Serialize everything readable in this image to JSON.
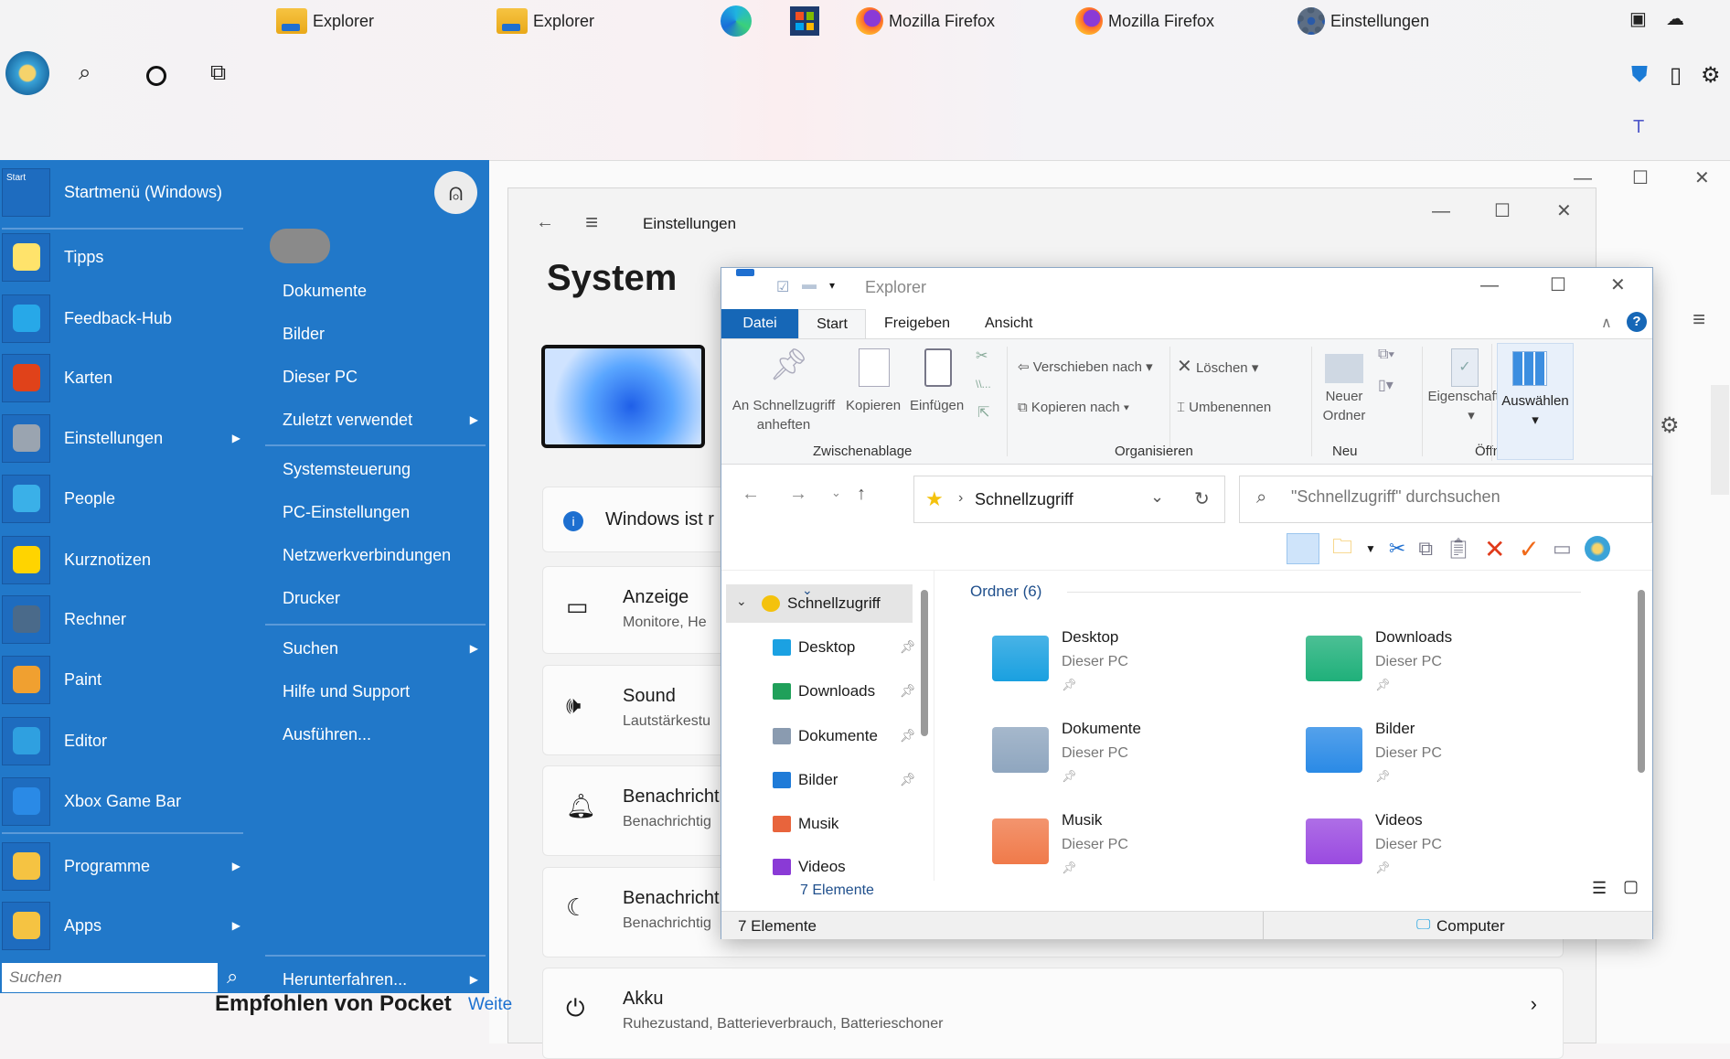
{
  "taskbar": {
    "items": [
      {
        "label": "Explorer",
        "icon": "folder-icon"
      },
      {
        "label": "Explorer",
        "icon": "folder-icon"
      },
      {
        "label": "",
        "icon": "edge-icon"
      },
      {
        "label": "",
        "icon": "store-icon"
      },
      {
        "label": "Mozilla Firefox",
        "icon": "firefox-icon"
      },
      {
        "label": "Mozilla Firefox",
        "icon": "firefox-icon"
      },
      {
        "label": "Einstellungen",
        "icon": "gear-icon"
      }
    ]
  },
  "start_menu": {
    "header": "Startmenü (Windows)",
    "left": [
      {
        "label": "Tipps"
      },
      {
        "label": "Feedback-Hub"
      },
      {
        "label": "Karten"
      },
      {
        "label": "Einstellungen",
        "submenu": true
      },
      {
        "label": "People"
      },
      {
        "label": "Kurznotizen"
      },
      {
        "label": "Rechner"
      },
      {
        "label": "Paint"
      },
      {
        "label": "Editor"
      },
      {
        "label": "Xbox Game Bar"
      },
      {
        "label": "Programme",
        "submenu": true
      },
      {
        "label": "Apps",
        "submenu": true
      }
    ],
    "right": [
      {
        "label": "Dokumente"
      },
      {
        "label": "Bilder"
      },
      {
        "label": "Dieser PC"
      },
      {
        "label": "Zuletzt verwendet",
        "submenu": true
      },
      {
        "label": "Systemsteuerung"
      },
      {
        "label": "PC-Einstellungen"
      },
      {
        "label": "Netzwerkverbindungen"
      },
      {
        "label": "Drucker"
      },
      {
        "label": "Suchen",
        "submenu": true
      },
      {
        "label": "Hilfe und Support"
      },
      {
        "label": "Ausführen..."
      }
    ],
    "shutdown": "Herunterfahren...",
    "search_placeholder": "Suchen",
    "accent": "#2178c9"
  },
  "settings": {
    "title": "Einstellungen",
    "heading": "System",
    "banner": "Windows ist r",
    "cards": [
      {
        "title": "Anzeige",
        "sub": "Monitore, He"
      },
      {
        "title": "Sound",
        "sub": "Lautstärkestu"
      },
      {
        "title": "Benachricht",
        "sub": "Benachrichtig"
      },
      {
        "title": "Benachricht",
        "sub": "Benachrichtig"
      },
      {
        "title": "Akku",
        "sub": "Ruhezustand, Batterieverbrauch, Batterieschoner"
      }
    ],
    "pocket": "Empfohlen von Pocket",
    "pocket_link": "Weite"
  },
  "explorer": {
    "title": "Explorer",
    "tabs": [
      "Datei",
      "Start",
      "Freigeben",
      "Ansicht"
    ],
    "ribbon": {
      "pin": "An Schnellzugriff anheften",
      "copy": "Kopieren",
      "paste": "Einfügen",
      "move": "Verschieben nach",
      "copyto": "Kopieren nach",
      "delete": "Löschen",
      "rename": "Umbenennen",
      "newfolder": "Neuer Ordner",
      "props": "Eigenschaften",
      "select": "Auswählen",
      "groups": [
        "Zwischenablage",
        "Organisieren",
        "Neu",
        "Öffnen"
      ]
    },
    "address": "Schnellzugriff",
    "search_placeholder": "\"Schnellzugriff\" durchsuchen",
    "nav": [
      {
        "label": "Schnellzugriff",
        "color": "#f4c20d"
      },
      {
        "label": "Desktop",
        "color": "#1ba1e2",
        "pinned": true
      },
      {
        "label": "Downloads",
        "color": "#20a05a",
        "pinned": true
      },
      {
        "label": "Dokumente",
        "color": "#8a9bb0",
        "pinned": true
      },
      {
        "label": "Bilder",
        "color": "#1f7bd8",
        "pinned": true
      },
      {
        "label": "Musik",
        "color": "#e8643c"
      },
      {
        "label": "Videos",
        "color": "#8a3ad6"
      }
    ],
    "group_header": "Ordner (6)",
    "folders": [
      {
        "name": "Desktop",
        "loc": "Dieser PC",
        "color": "#1aa0e0"
      },
      {
        "name": "Downloads",
        "loc": "Dieser PC",
        "color": "#1fb07a"
      },
      {
        "name": "Dokumente",
        "loc": "Dieser PC",
        "color": "#8fa6bf"
      },
      {
        "name": "Bilder",
        "loc": "Dieser PC",
        "color": "#2a8ae6"
      },
      {
        "name": "Musik",
        "loc": "Dieser PC",
        "color": "#f07a4a"
      },
      {
        "name": "Videos",
        "loc": "Dieser PC",
        "color": "#9a4ae0"
      }
    ],
    "count": "7 Elemente",
    "status_count": "7 Elemente",
    "status_location": "Computer"
  }
}
